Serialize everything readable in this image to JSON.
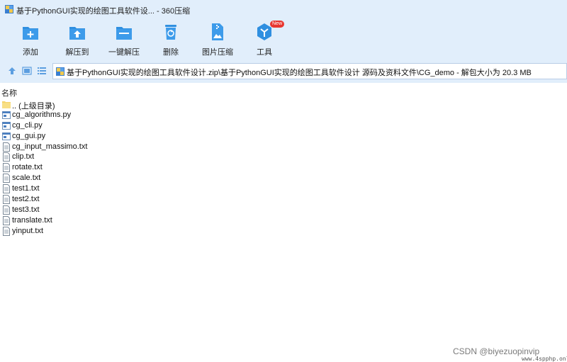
{
  "window": {
    "title": "基于PythonGUI实现的绘图工具软件设... - 360压缩"
  },
  "toolbar": {
    "items": [
      {
        "label": "添加",
        "icon": "add-folder-icon"
      },
      {
        "label": "解压到",
        "icon": "extract-to-icon"
      },
      {
        "label": "一键解压",
        "icon": "one-click-extract-icon"
      },
      {
        "label": "删除",
        "icon": "recycle-bin-icon"
      },
      {
        "label": "图片压缩",
        "icon": "image-compress-icon"
      },
      {
        "label": "工具",
        "icon": "tools-cube-icon",
        "badge": "New"
      }
    ]
  },
  "address": {
    "path": "基于PythonGUI实现的绘图工具软件设计.zip\\基于PythonGUI实现的绘图工具软件设计 源码及资料文件\\CG_demo - 解包大小为 20.3 MB"
  },
  "list": {
    "column_name": "名称",
    "items": [
      {
        "name": ".. (上级目录)",
        "type": "parent-folder"
      },
      {
        "name": "cg_algorithms.py",
        "type": "py"
      },
      {
        "name": "cg_cli.py",
        "type": "py"
      },
      {
        "name": "cg_gui.py",
        "type": "py"
      },
      {
        "name": "cg_input_massimo.txt",
        "type": "txt"
      },
      {
        "name": "clip.txt",
        "type": "txt"
      },
      {
        "name": "rotate.txt",
        "type": "txt"
      },
      {
        "name": "scale.txt",
        "type": "txt"
      },
      {
        "name": "test1.txt",
        "type": "txt"
      },
      {
        "name": "test2.txt",
        "type": "txt"
      },
      {
        "name": "test3.txt",
        "type": "txt"
      },
      {
        "name": "translate.txt",
        "type": "txt"
      },
      {
        "name": "yinput.txt",
        "type": "txt"
      }
    ]
  },
  "watermark": {
    "text": "CSDN @biyezuopinvip",
    "site": "www.4spphp.online"
  },
  "colors": {
    "chrome_bg": "#e1eefb",
    "icon_blue": "#2f8fe0",
    "badge_red": "#e8362f",
    "folder_yellow": "#f5d36b"
  }
}
